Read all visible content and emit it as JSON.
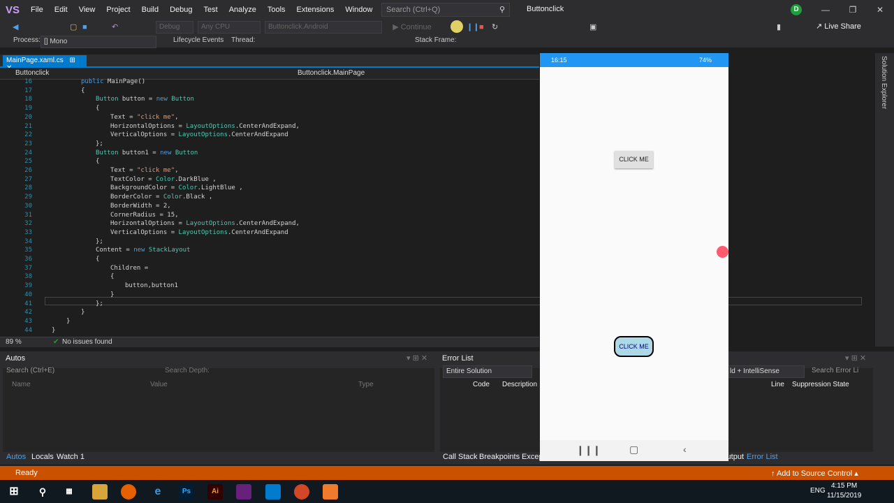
{
  "menubar": {
    "logo": "VS",
    "items": [
      "File",
      "Edit",
      "View",
      "Project",
      "Build",
      "Debug",
      "Test",
      "Analyze",
      "Tools",
      "Extensions",
      "Window",
      "Help"
    ],
    "search_placeholder": "Search (Ctrl+Q)",
    "window_title": "Buttonclick",
    "avatar": "D"
  },
  "toolbar": {
    "config": "Debug",
    "platform": "Any CPU",
    "startup": "Buttonclick.Android",
    "continue": "Continue",
    "live_share": "Live Share"
  },
  "procbar": {
    "process_label": "Process:",
    "process_value": "[] Mono",
    "lifecycle": "Lifecycle Events",
    "thread": "Thread:",
    "stack_frame": "Stack Frame:"
  },
  "editor": {
    "tab": "MainPage.xaml.cs",
    "nav_left": "Buttonclick",
    "nav_right": "Buttonclick.MainPage",
    "zoom": "89 %",
    "issues": "No issues found",
    "lines": [
      {
        "n": "16",
        "code": "public MainPage()",
        "indent": 0
      },
      {
        "n": "17",
        "code": "{",
        "indent": 0
      },
      {
        "n": "18",
        "code": "Button button = new Button",
        "indent": 1
      },
      {
        "n": "19",
        "code": "{",
        "indent": 1
      },
      {
        "n": "20",
        "code": "Text = \"click me\",",
        "indent": 2
      },
      {
        "n": "21",
        "code": "HorizontalOptions = LayoutOptions.CenterAndExpand,",
        "indent": 2
      },
      {
        "n": "22",
        "code": "VerticalOptions = LayoutOptions.CenterAndExpand",
        "indent": 2
      },
      {
        "n": "23",
        "code": "};",
        "indent": 1
      },
      {
        "n": "24",
        "code": "Button button1 = new Button",
        "indent": 1
      },
      {
        "n": "25",
        "code": "{",
        "indent": 1
      },
      {
        "n": "26",
        "code": "Text = \"click me\",",
        "indent": 2
      },
      {
        "n": "27",
        "code": "TextColor = Color.DarkBlue ,",
        "indent": 2
      },
      {
        "n": "28",
        "code": "BackgroundColor = Color.LightBlue ,",
        "indent": 2
      },
      {
        "n": "29",
        "code": "BorderColor = Color.Black ,",
        "indent": 2
      },
      {
        "n": "30",
        "code": "BorderWidth = 2,",
        "indent": 2
      },
      {
        "n": "31",
        "code": "CornerRadius = 15,",
        "indent": 2
      },
      {
        "n": "32",
        "code": "HorizontalOptions = LayoutOptions.CenterAndExpand,",
        "indent": 2
      },
      {
        "n": "33",
        "code": "VerticalOptions = LayoutOptions.CenterAndExpand",
        "indent": 2
      },
      {
        "n": "34",
        "code": "};",
        "indent": 1
      },
      {
        "n": "35",
        "code": "Content = new StackLayout",
        "indent": 1
      },
      {
        "n": "36",
        "code": "{",
        "indent": 1
      },
      {
        "n": "37",
        "code": "Children =",
        "indent": 2
      },
      {
        "n": "38",
        "code": "{",
        "indent": 2
      },
      {
        "n": "39",
        "code": "button,button1",
        "indent": 3
      },
      {
        "n": "40",
        "code": "}",
        "indent": 2
      },
      {
        "n": "41",
        "code": "};",
        "indent": 1
      },
      {
        "n": "42",
        "code": "}",
        "indent": 0
      },
      {
        "n": "43",
        "code": "}",
        "indent": -1
      },
      {
        "n": "44",
        "code": "}",
        "indent": -2
      }
    ]
  },
  "autos": {
    "title": "Autos",
    "search": "Search (Ctrl+E)",
    "depth": "Search Depth:",
    "cols": [
      "Name",
      "Value",
      "Type"
    ],
    "tabs": [
      "Autos",
      "Locals",
      "Watch 1"
    ]
  },
  "errors": {
    "title": "Error List",
    "scope": "Entire Solution",
    "build": "ld + IntelliSense",
    "search": "Search Error Li",
    "cols": [
      "Code",
      "Description",
      "Line",
      "Suppression State"
    ],
    "tabs": [
      "Call Stack",
      "Breakpoints",
      "Excep",
      "Output",
      "Error List"
    ]
  },
  "status": {
    "ready": "Ready",
    "source_control": "Add to Source Control"
  },
  "taskbar": {
    "lang": "ENG",
    "time": "4:15 PM",
    "date": "11/15/2019"
  },
  "phone": {
    "time": "16:15",
    "battery": "74%",
    "button1": "CLICK ME",
    "button2": "CLICK ME"
  },
  "solution_explorer": "Solution Explorer"
}
